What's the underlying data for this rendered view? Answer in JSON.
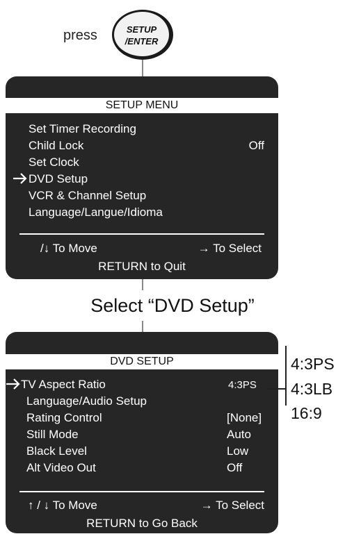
{
  "press": {
    "label": "press",
    "button_line1": "SETUP",
    "button_line2": "/ENTER"
  },
  "setup_menu": {
    "title": "SETUP MENU",
    "items": [
      {
        "label": "Set Timer Recording",
        "value": ""
      },
      {
        "label": "Child Lock",
        "value": "Off"
      },
      {
        "label": "Set Clock",
        "value": ""
      },
      {
        "label": "DVD Setup",
        "value": "",
        "selected": true
      },
      {
        "label": "VCR & Channel Setup",
        "value": ""
      },
      {
        "label": "Language/Langue/Idioma",
        "value": ""
      }
    ],
    "move_hint": "/↓ To Move",
    "select_hint": "→ To Select",
    "quit_hint": "RETURN to Quit"
  },
  "caption": "Select “DVD Setup”",
  "dvd_menu": {
    "title": "DVD SETUP",
    "items": [
      {
        "label": "TV Aspect Ratio",
        "value": "4:3PS",
        "selected": true
      },
      {
        "label": "Language/Audio Setup",
        "value": ""
      },
      {
        "label": "Rating Control",
        "value": "[None]"
      },
      {
        "label": "Still Mode",
        "value": "Auto"
      },
      {
        "label": "Black Level",
        "value": "Low"
      },
      {
        "label": "Alt Video Out",
        "value": "Off"
      }
    ],
    "move_hint": "↑ / ↓ To Move",
    "select_hint": "→ To Select",
    "back_hint": "RETURN to Go Back"
  },
  "aspect_options": [
    "4:3PS",
    "4:3LB",
    "16:9"
  ],
  "colors": {
    "panel": "#262626",
    "text_on_panel": "#ffffff",
    "title_bar": "#ffffff"
  }
}
